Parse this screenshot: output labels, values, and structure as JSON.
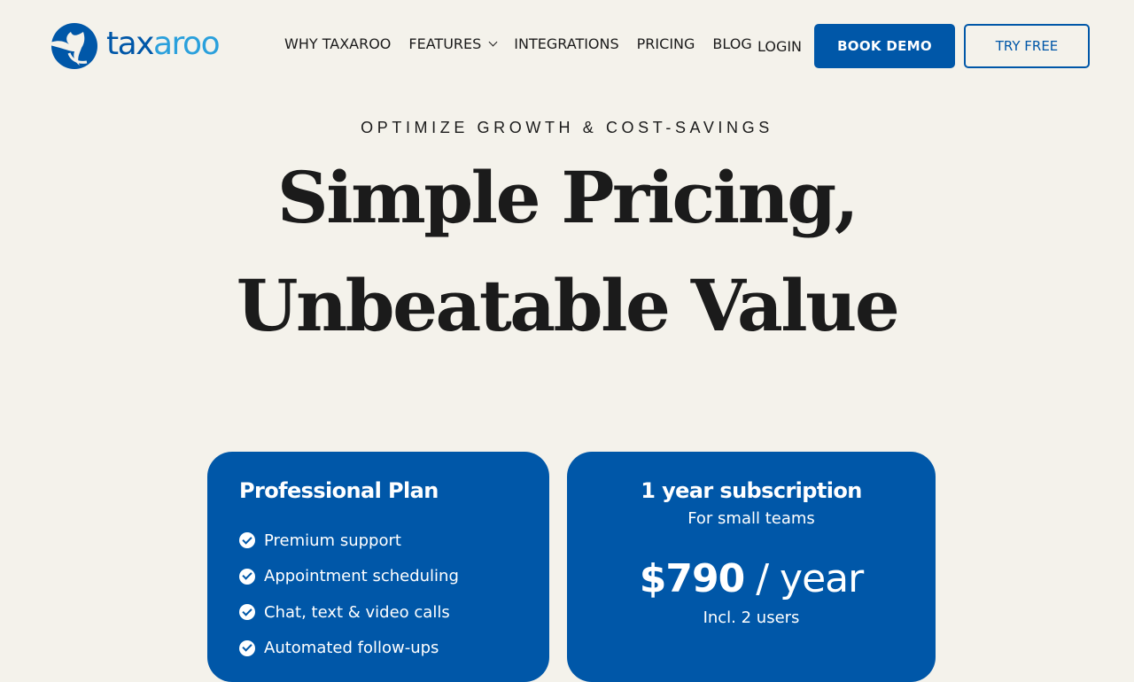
{
  "header": {
    "logo_text_main": "tax",
    "logo_text_accent": "aroo",
    "nav": {
      "why": "WHY TAXAROO",
      "features": "FEATURES",
      "integrations": "INTEGRATIONS",
      "pricing": "PRICING",
      "blog": "BLOG"
    },
    "login": "LOGIN",
    "book_demo": "BOOK DEMO",
    "try_free": "TRY FREE"
  },
  "hero": {
    "eyebrow": "OPTIMIZE GROWTH & COST-SAVINGS",
    "title_line1": "Simple Pricing,",
    "title_line2": "Unbeatable Value"
  },
  "plans": {
    "professional": {
      "title": "Professional Plan",
      "features": [
        "Premium support",
        "Appointment scheduling",
        "Chat, text & video calls",
        "Automated follow-ups"
      ]
    },
    "subscription": {
      "title": "1 year subscription",
      "tagline": "For small teams",
      "price": "$790",
      "period": " / year",
      "users": "Incl. 2 users"
    }
  },
  "colors": {
    "brand_blue": "#0057a8",
    "logo_light_blue": "#2aa0dc",
    "background": "#f4f2eb"
  },
  "icons": [
    "kangaroo-logo-icon",
    "chevron-down-icon",
    "check-circle-icon"
  ]
}
